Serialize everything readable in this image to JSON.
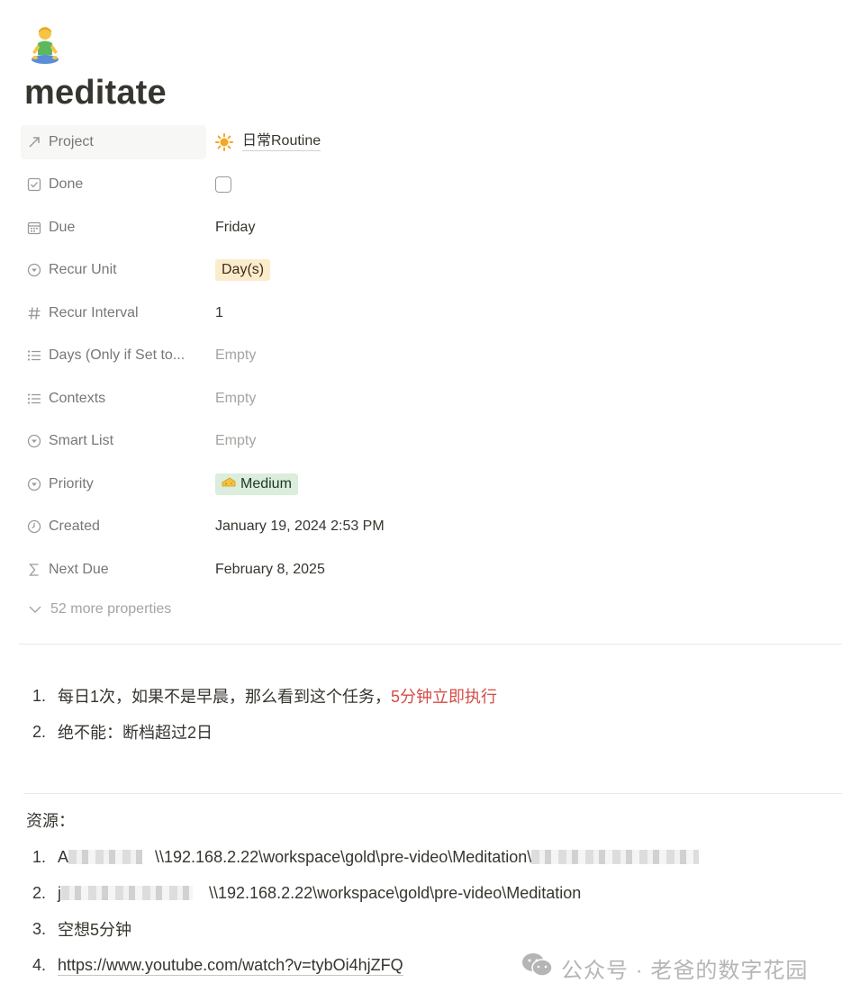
{
  "page": {
    "icon_name": "meditation-person-icon",
    "title": "meditate"
  },
  "properties": [
    {
      "icon": "relation-arrow-icon",
      "name": "Project",
      "type": "relation",
      "value": "日常Routine",
      "value_icon": "sun-icon"
    },
    {
      "icon": "checkbox-prop-icon",
      "name": "Done",
      "type": "checkbox",
      "value": ""
    },
    {
      "icon": "calendar-icon",
      "name": "Due",
      "type": "text",
      "value": "Friday"
    },
    {
      "icon": "select-icon",
      "name": "Recur Unit",
      "type": "tag",
      "value": "Day(s)",
      "tag_color": "#fbeccc"
    },
    {
      "icon": "hash-icon",
      "name": "Recur Interval",
      "type": "text",
      "value": "1"
    },
    {
      "icon": "list-icon",
      "name": "Days (Only if Set to...",
      "type": "empty",
      "value": "Empty"
    },
    {
      "icon": "list-icon",
      "name": "Contexts",
      "type": "empty",
      "value": "Empty"
    },
    {
      "icon": "select-icon",
      "name": "Smart List",
      "type": "empty",
      "value": "Empty"
    },
    {
      "icon": "select-icon",
      "name": "Priority",
      "type": "tag",
      "value": "Medium",
      "tag_color": "#dbeddb",
      "tag_emoji": "🧀"
    },
    {
      "icon": "clock-icon",
      "name": "Created",
      "type": "text",
      "value": "January 19, 2024 2:53 PM"
    },
    {
      "icon": "sigma-icon",
      "name": "Next Due",
      "type": "text",
      "value": "February 8, 2025"
    }
  ],
  "more_properties": "52 more properties",
  "rules": [
    {
      "num": "1.",
      "text": "每日1次，如果不是早晨，那么看到这个任务，",
      "highlight": "5分钟立即执行"
    },
    {
      "num": "2.",
      "text": "绝不能：断档超过2日"
    }
  ],
  "resources": {
    "heading": "资源：",
    "items": [
      {
        "num": "1.",
        "prefix": "A",
        "path": "\\\\192.168.2.22\\workspace\\gold\\pre-video\\Meditation\\"
      },
      {
        "num": "2.",
        "prefix": "j",
        "path": "\\\\192.168.2.22\\workspace\\gold\\pre-video\\Meditation"
      },
      {
        "num": "3.",
        "text": "空想5分钟"
      },
      {
        "num": "4.",
        "link": "https://www.youtube.com/watch?v=tybOi4hjZFQ"
      }
    ]
  },
  "watermark": "公众号 · 老爸的数字花园",
  "colors": {
    "text": "#37352f",
    "muted": "#787774",
    "empty": "#a5a4a0",
    "red": "#d44c47",
    "yellow_tag": "#fbeccc",
    "green_tag": "#dbeddb",
    "divider": "#e9e9e7"
  }
}
